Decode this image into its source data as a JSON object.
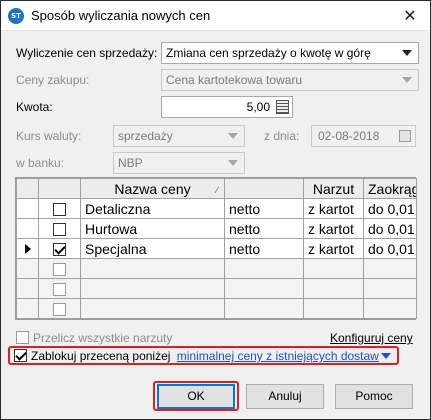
{
  "window": {
    "title": "Sposób wyliczania nowych cen",
    "close_glyph": "✕",
    "app_icon_text": "ST"
  },
  "form": {
    "calc_label": "Wyliczenie cen sprzedaży:",
    "calc_value": "Zmiana cen sprzedaży o kwotę w górę",
    "purchase_label": "Ceny zakupu:",
    "purchase_value": "Cena kartotekowa towaru",
    "amount_label": "Kwota:",
    "amount_value": "5,00",
    "rate_label": "Kurs waluty:",
    "rate_value": "sprzedaży",
    "date_label": "z dnia:",
    "date_value": "02-08-2018",
    "bank_label": "w banku:",
    "bank_value": "NBP"
  },
  "grid": {
    "columns": [
      "Nazwa ceny",
      "",
      "Narzut",
      "Zaokrąg"
    ],
    "sort_glyph": "⁄",
    "rows": [
      {
        "name": "Detaliczna",
        "basis": "netto",
        "markup": "z kartot",
        "round": "do 0,01",
        "checked": false,
        "current": false
      },
      {
        "name": "Hurtowa",
        "basis": "netto",
        "markup": "z kartot",
        "round": "do 0,01",
        "checked": false,
        "current": false
      },
      {
        "name": "Specjalna",
        "basis": "netto",
        "markup": "z kartot",
        "round": "do 0,01",
        "checked": true,
        "current": true
      }
    ]
  },
  "options": {
    "recalc_label": "Przelicz wszystkie narzuty",
    "configure_label": "Konfiguruj ceny",
    "block_label": "Zablokuj przeceną poniżej",
    "block_link": "minimalnej ceny z istniejących dostaw",
    "block_checked": true
  },
  "buttons": {
    "ok": "OK",
    "cancel": "Anuluj",
    "help": "Pomoc"
  },
  "colors": {
    "highlight": "#e02020",
    "link": "#1d4fd0",
    "default_button": "#0078d7"
  }
}
